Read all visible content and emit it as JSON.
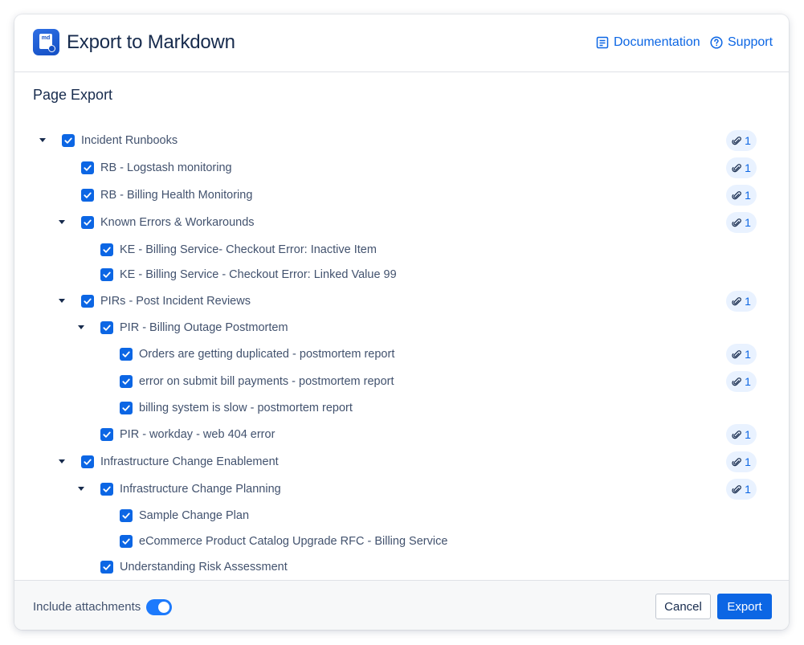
{
  "header": {
    "logo_text": "md",
    "title": "Export to Markdown",
    "links": [
      {
        "label": "Documentation",
        "icon": "document-icon"
      },
      {
        "label": "Support",
        "icon": "help-icon"
      }
    ]
  },
  "section": {
    "title": "Page Export"
  },
  "tree": [
    {
      "label": "Incident Runbooks",
      "level": 0,
      "expandable": true,
      "checked": true,
      "attachments": "1"
    },
    {
      "label": "RB - Logstash monitoring",
      "level": 1,
      "expandable": false,
      "checked": true,
      "attachments": "1"
    },
    {
      "label": "RB - Billing Health Monitoring",
      "level": 1,
      "expandable": false,
      "checked": true,
      "attachments": "1"
    },
    {
      "label": "Known Errors & Workarounds",
      "level": 1,
      "expandable": true,
      "checked": true,
      "attachments": "1"
    },
    {
      "label": "KE - Billing Service- Checkout Error: Inactive Item",
      "level": 2,
      "expandable": false,
      "checked": true,
      "attachments": null
    },
    {
      "label": "KE - Billing Service - Checkout Error: Linked Value 99",
      "level": 2,
      "expandable": false,
      "checked": true,
      "attachments": null
    },
    {
      "label": "PIRs - Post Incident Reviews",
      "level": 1,
      "expandable": true,
      "checked": true,
      "attachments": "1"
    },
    {
      "label": "PIR - Billing Outage Postmortem",
      "level": 2,
      "expandable": true,
      "checked": true,
      "attachments": null
    },
    {
      "label": "Orders are getting duplicated - postmortem report",
      "level": 3,
      "expandable": false,
      "checked": true,
      "attachments": "1"
    },
    {
      "label": "error on submit bill payments - postmortem report",
      "level": 3,
      "expandable": false,
      "checked": true,
      "attachments": "1"
    },
    {
      "label": "billing system is slow - postmortem report",
      "level": 3,
      "expandable": false,
      "checked": true,
      "attachments": null
    },
    {
      "label": "PIR - workday - web 404 error",
      "level": 2,
      "expandable": false,
      "checked": true,
      "attachments": "1"
    },
    {
      "label": "Infrastructure Change Enablement",
      "level": 1,
      "expandable": true,
      "checked": true,
      "attachments": "1"
    },
    {
      "label": "Infrastructure Change Planning",
      "level": 2,
      "expandable": true,
      "checked": true,
      "attachments": "1"
    },
    {
      "label": "Sample Change Plan",
      "level": 3,
      "expandable": false,
      "checked": true,
      "attachments": null
    },
    {
      "label": "eCommerce Product Catalog Upgrade RFC - Billing Service",
      "level": 3,
      "expandable": false,
      "checked": true,
      "attachments": null
    },
    {
      "label": "Understanding Risk Assessment",
      "level": 2,
      "expandable": false,
      "checked": true,
      "attachments": null
    }
  ],
  "footer": {
    "toggle_label": "Include attachments",
    "toggle_on": true,
    "cancel_label": "Cancel",
    "export_label": "Export"
  },
  "colors": {
    "accent": "#0c66e4",
    "badge_bg": "#e9f2ff",
    "footer_bg": "#f7f8f9"
  }
}
